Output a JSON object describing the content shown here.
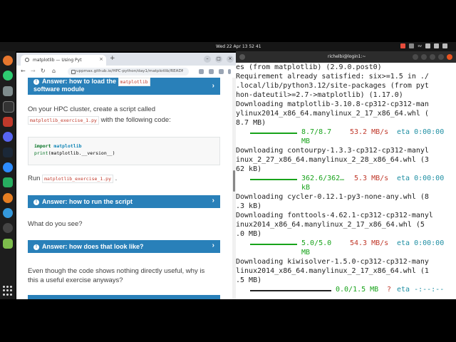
{
  "topbar": {
    "clock": "Wed 22 Apr  13 52 41",
    "tray_label": "sv"
  },
  "browser": {
    "tab_title": "matplotlib — Using Pyt",
    "new_tab": "+",
    "url": "uppmax.github.io/HPC-python/day1/matplotlib/READM...",
    "answer1_line1": "Answer: how to load the",
    "answer1_code": "matplotlib",
    "answer1_line2": "software module",
    "intro": "On your HPC cluster, create a script called",
    "script_name": "matplotlib_exercise_1.py",
    "intro2": "with the following code:",
    "code_import_kw": "import",
    "code_import_mod": "matplotlib",
    "code_print_fn": "print",
    "code_print_arg": "(matplotlib.__version__)",
    "run_label": "Run",
    "run_script": "matplotlib_exercise_1.py",
    "run_period": ".",
    "answer2": "Answer: how to run the script",
    "question1": "What do you see?",
    "answer3": "Answer: how does that look like?",
    "question2_line1": "Even though the code shows nothing directly useful, why is",
    "question2_line2": "this a useful exercise anyways?"
  },
  "terminal": {
    "title": "richelbi@login1:~",
    "lines": [
      "es (from matplotlib) (2.9.0.post0)",
      "Requirement already satisfied: six>=1.5 in ./",
      ".local/lib/python3.12/site-packages (from pyt",
      "hon-dateutil>=2.7->matplotlib) (1.17.0)",
      "Downloading matplotlib-3.10.8-cp312-cp312-man",
      "ylinux2014_x86_64.manylinux_2_17_x86_64.whl (",
      "8.7 MB)"
    ],
    "p1_size": "8.7/8.7",
    "p1_unit": "MB",
    "p1_speed": "53.2 MB/s",
    "p1_eta": "eta 0:00:00",
    "lines2": [
      "Downloading contourpy-1.3.3-cp312-cp312-manyl",
      "inux_2_27_x86_64.manylinux_2_28_x86_64.whl (3",
      "62 kB)"
    ],
    "p2_size": "362.6/362…",
    "p2_unit": "kB",
    "p2_speed": "5.3 MB/s",
    "p2_eta": "eta 0:00:00",
    "lines3": [
      "Downloading cycler-0.12.1-py3-none-any.whl (8",
      ".3 kB)",
      "Downloading fonttools-4.62.1-cp312-cp312-manyl",
      "inux2014_x86_64.manylinux_2_17_x86_64.whl (5",
      ".0 MB)"
    ],
    "p3_size": "5.0/5.0",
    "p3_unit": "MB",
    "p3_speed": "54.3 MB/s",
    "p3_eta": "eta 0:00:00",
    "lines4": [
      "Downloading kiwisolver-1.5.0-cp312-cp312-many",
      "linux2014_x86_64.manylinux_2_17_x86_64.whl (1",
      ".5 MB)"
    ],
    "p4_size": "0.0/1.5 MB",
    "p4_q": "?",
    "p4_eta": "eta -:--:--"
  }
}
